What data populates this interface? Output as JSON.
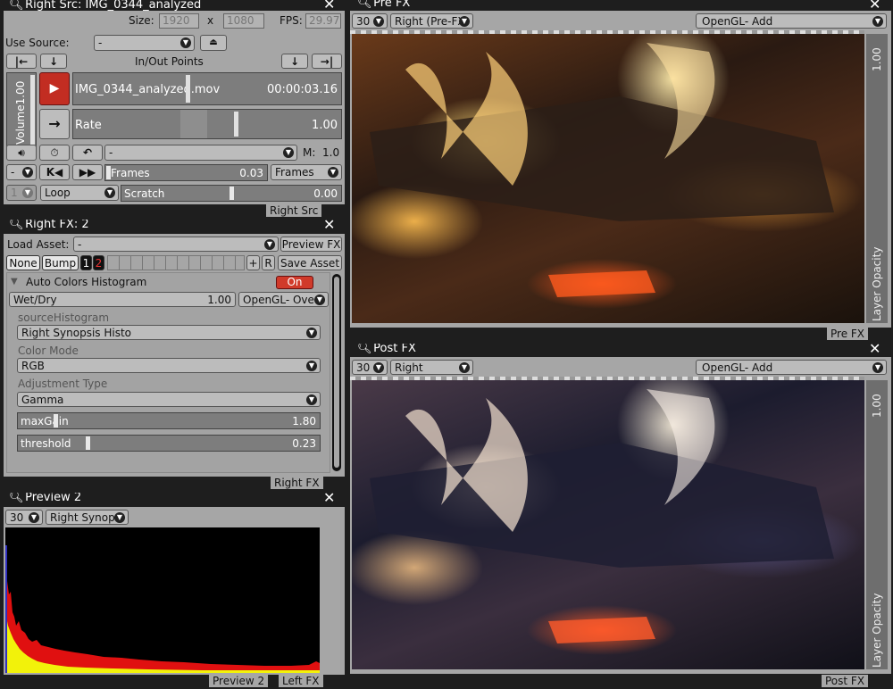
{
  "right_src": {
    "title": "Right Src: IMG_0344_analyzed",
    "size_label": "Size:",
    "width": "1920",
    "x_label": "x",
    "height": "1080",
    "fps_label": "FPS:",
    "fps": "29.97",
    "use_source_label": "Use Source:",
    "use_source_value": "-",
    "in_out_label": "In/Out Points",
    "volume_label": "Volume",
    "volume_value": "1.00",
    "clip_name": "IMG_0344_analyzed.mov",
    "clip_time": "00:00:03.16",
    "rate_label": "Rate",
    "rate_value": "1.00",
    "mode_select_value": "-",
    "m_label": "M:",
    "m_value": "1.0",
    "small_select_value": "-",
    "frames_label": "Frames",
    "frames_value": "0.03",
    "frames_unit": "Frames",
    "loop_index": "1",
    "loop_mode": "Loop",
    "scratch_label": "Scratch",
    "scratch_value": "0.00",
    "footer": "Right Src"
  },
  "right_fx": {
    "title": "Right FX: 2",
    "load_asset_label": "Load Asset:",
    "load_asset_value": "-",
    "preview_fx_button": "Preview FX",
    "tab_none": "None",
    "tab_bump": "Bump",
    "tab_1": "1",
    "tab_2": "2",
    "plus_button": "+",
    "r_button": "R",
    "save_asset_button": "Save Asset",
    "effect_name": "Auto Colors Histogram",
    "on_button": "On",
    "wetdry_label": "Wet/Dry",
    "wetdry_value": "1.00",
    "blend_mode": "OpenGL- Ove",
    "source_histogram_label": "sourceHistogram",
    "source_histogram_value": "Right Synopsis Histo",
    "color_mode_label": "Color Mode",
    "color_mode_value": "RGB",
    "adjustment_type_label": "Adjustment Type",
    "adjustment_type_value": "Gamma",
    "maxgain_label": "maxGain",
    "maxgain_value": "1.80",
    "maxgain_level": 0.12,
    "threshold_label": "threshold",
    "threshold_value": "0.23",
    "threshold_level": 0.23,
    "footer": "Right FX"
  },
  "preview2": {
    "title": "Preview 2",
    "fps_value": "30",
    "source_value": "Right Synop",
    "footer_a": "Preview 2",
    "footer_b": "Left FX"
  },
  "pre_fx": {
    "title": "Pre FX",
    "fps_value": "30",
    "source_value": "Right (Pre-FX",
    "blend_value": "OpenGL- Add",
    "opacity_value": "1.00",
    "opacity_label": "Layer Opacity",
    "footer": "Pre FX"
  },
  "post_fx": {
    "title": "Post FX",
    "fps_value": "30",
    "source_value": "Right",
    "blend_value": "OpenGL- Add",
    "opacity_value": "1.00",
    "opacity_label": "Layer Opacity",
    "footer": "Post FX"
  },
  "colors": {
    "panel": "#a6a6a6",
    "on_red": "#d03a2a",
    "play_red": "#c22d22",
    "hist_red": "#e01010",
    "hist_yellow": "#f2f20a"
  },
  "icons": [
    "search-icon",
    "close-icon",
    "chevron-down-icon",
    "eject-icon",
    "go-to-start-icon",
    "go-to-end-icon",
    "arrow-down-icon",
    "play-icon",
    "arrow-right-icon",
    "speaker-icon",
    "timer-icon",
    "undo-icon",
    "skip-back-icon",
    "skip-forward-icon",
    "collapse-triangle-icon"
  ]
}
